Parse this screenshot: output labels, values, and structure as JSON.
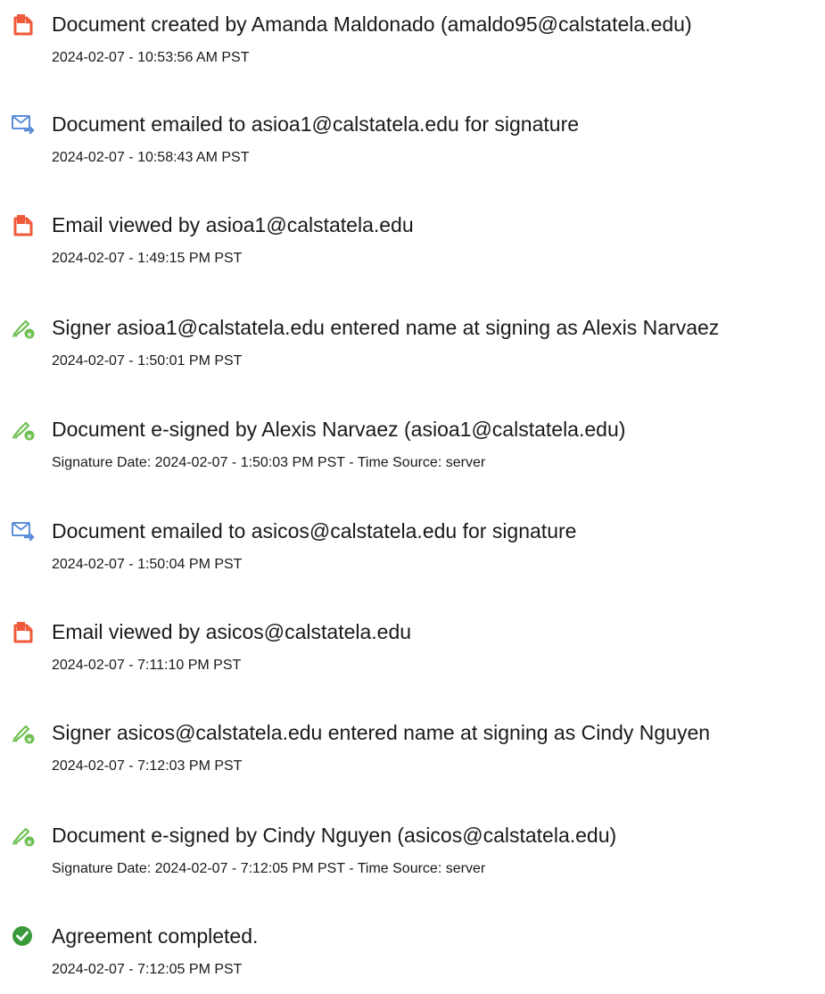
{
  "events": [
    {
      "icon": "document-created-icon",
      "title": "Document created by Amanda Maldonado (amaldo95@calstatela.edu)",
      "time": "2024-02-07 - 10:53:56 AM PST"
    },
    {
      "icon": "email-sent-icon",
      "title": "Document emailed to asioa1@calstatela.edu for signature",
      "time": "2024-02-07 - 10:58:43 AM PST"
    },
    {
      "icon": "document-viewed-icon",
      "title": "Email viewed by asioa1@calstatela.edu",
      "time": "2024-02-07 - 1:49:15 PM PST"
    },
    {
      "icon": "esign-pen-icon",
      "title": "Signer asioa1@calstatela.edu entered name at signing as Alexis Narvaez",
      "time": "2024-02-07 - 1:50:01 PM PST"
    },
    {
      "icon": "esign-pen-icon",
      "title": "Document e-signed by Alexis Narvaez (asioa1@calstatela.edu)",
      "time": "Signature Date: 2024-02-07 - 1:50:03 PM PST - Time Source: server"
    },
    {
      "icon": "email-sent-icon",
      "title": "Document emailed to asicos@calstatela.edu for signature",
      "time": "2024-02-07 - 1:50:04 PM PST"
    },
    {
      "icon": "document-viewed-icon",
      "title": "Email viewed by asicos@calstatela.edu",
      "time": "2024-02-07 - 7:11:10 PM PST"
    },
    {
      "icon": "esign-pen-icon",
      "title": "Signer asicos@calstatela.edu entered name at signing as Cindy Nguyen",
      "time": "2024-02-07 - 7:12:03 PM PST"
    },
    {
      "icon": "esign-pen-icon",
      "title": "Document e-signed by Cindy Nguyen (asicos@calstatela.edu)",
      "time": "Signature Date: 2024-02-07 - 7:12:05 PM PST - Time Source: server"
    },
    {
      "icon": "completed-check-icon",
      "title": "Agreement completed.",
      "time": "2024-02-07 - 7:12:05 PM PST"
    }
  ],
  "colors": {
    "document_icon": "#ef5a3a",
    "email_icon": "#5b8ed8",
    "pen_icon": "#6fbf52",
    "complete_icon": "#3a9a3a",
    "text": "#1a1a1a"
  }
}
